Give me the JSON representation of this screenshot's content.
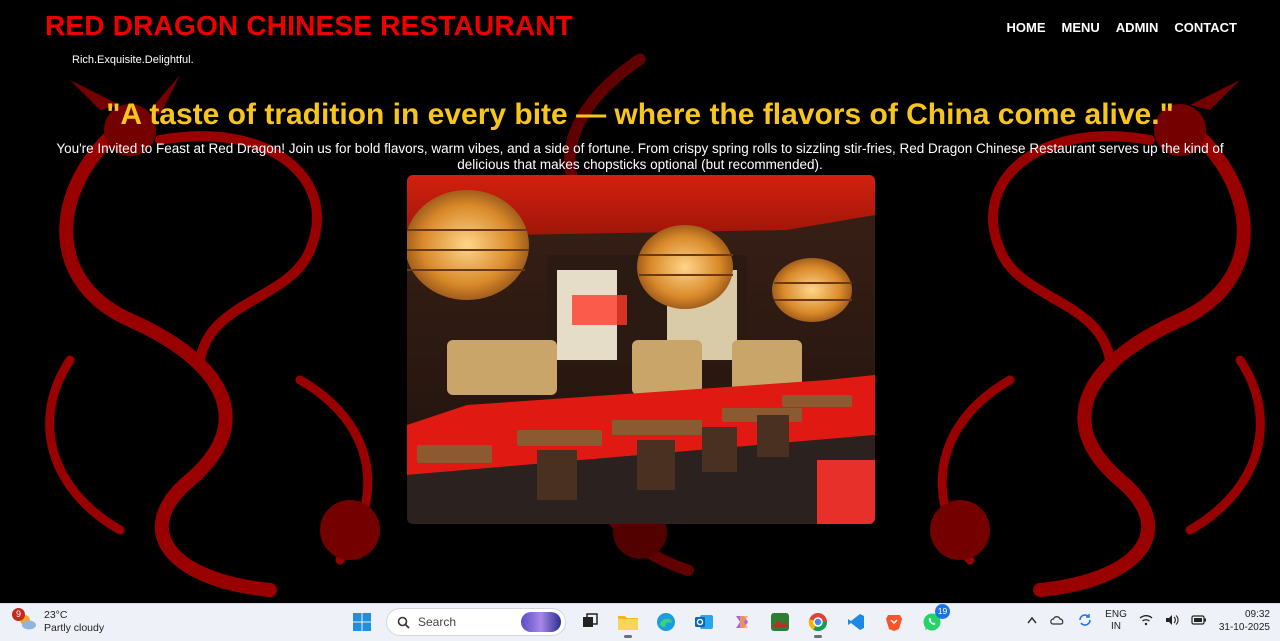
{
  "header": {
    "brand": "RED DRAGON CHINESE RESTAURANT",
    "tagline": "Rich.Exquisite.Delightful.",
    "nav": [
      "HOME",
      "MENU",
      "ADMIN",
      "CONTACT"
    ]
  },
  "hero": {
    "quote": "\"A taste of tradition in every bite — where the flavors of China come alive.\"",
    "intro": "You're Invited to Feast at Red Dragon! Join us for bold flavors, warm vibes, and a side of fortune. From crispy spring rolls to sizzling stir-fries, Red Dragon Chinese Restaurant serves up the kind of delicious that makes chopsticks optional (but recommended)."
  },
  "colors": {
    "brand": "#ee0000",
    "quote": "#f7c51c",
    "dragon": "#b40000"
  },
  "taskbar": {
    "weather_temp": "23°C",
    "weather_desc": "Partly cloudy",
    "weather_badge": "9",
    "search_placeholder": "Search",
    "whatsapp_badge": "19",
    "lang_top": "ENG",
    "lang_bottom": "IN",
    "time": "09:32",
    "date": "31-10-2025"
  }
}
